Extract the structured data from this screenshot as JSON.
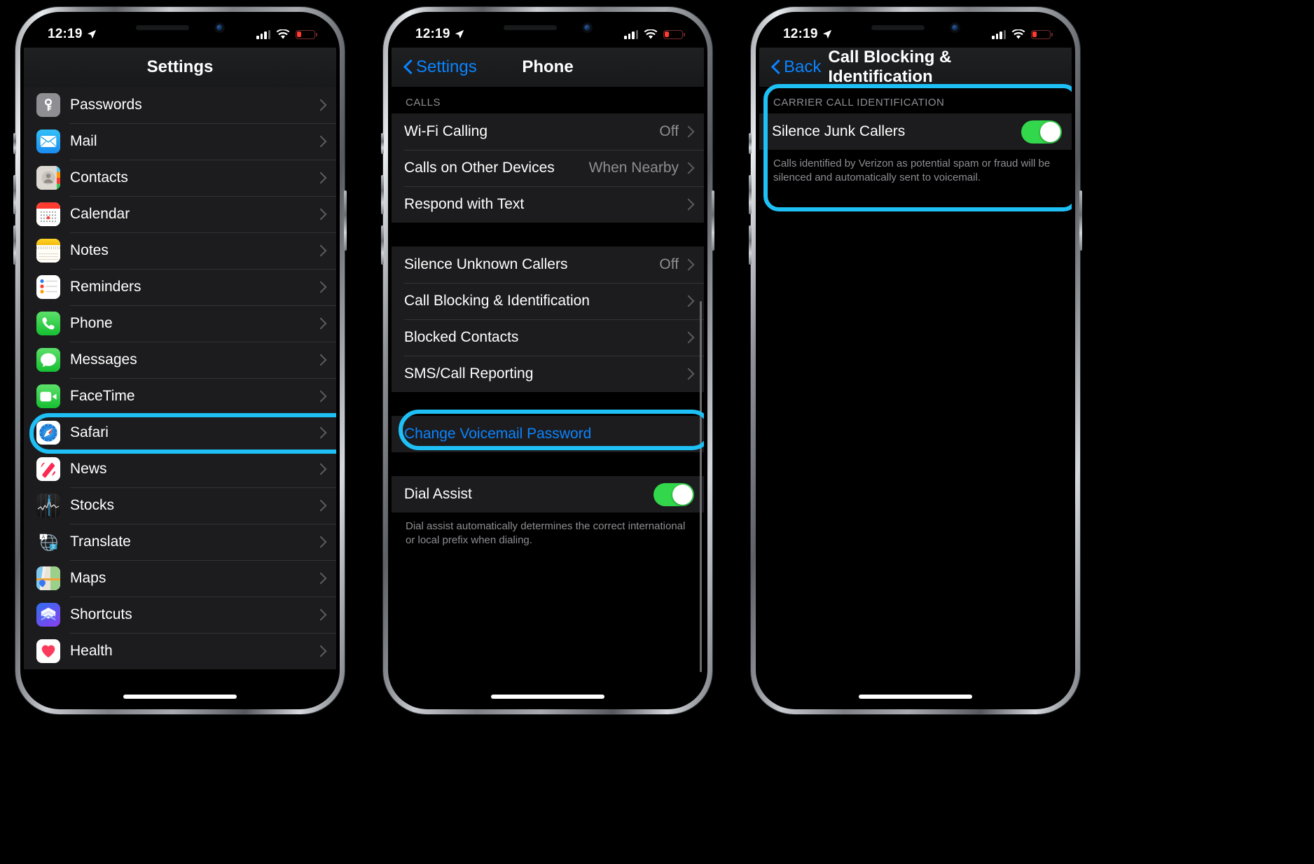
{
  "colors": {
    "highlight": "#1ec0f5",
    "accent_blue": "#0a84ff",
    "toggle_green": "#32d74b",
    "group_bg": "#1c1c1e",
    "secondary_text": "#8e8e93"
  },
  "status_bar": {
    "time": "12:19",
    "location_icon": "location-arrow-icon",
    "cellular_icon": "cellular-bars-icon",
    "wifi_icon": "wifi-icon",
    "battery_icon": "battery-low-icon"
  },
  "phone1": {
    "nav": {
      "title": "Settings"
    },
    "items": [
      {
        "label": "Passwords",
        "icon": "passwords-app-icon"
      },
      {
        "label": "Mail",
        "icon": "mail-app-icon"
      },
      {
        "label": "Contacts",
        "icon": "contacts-app-icon"
      },
      {
        "label": "Calendar",
        "icon": "calendar-app-icon"
      },
      {
        "label": "Notes",
        "icon": "notes-app-icon"
      },
      {
        "label": "Reminders",
        "icon": "reminders-app-icon"
      },
      {
        "label": "Phone",
        "icon": "phone-app-icon",
        "highlighted": true
      },
      {
        "label": "Messages",
        "icon": "messages-app-icon"
      },
      {
        "label": "FaceTime",
        "icon": "facetime-app-icon"
      },
      {
        "label": "Safari",
        "icon": "safari-app-icon"
      },
      {
        "label": "News",
        "icon": "news-app-icon"
      },
      {
        "label": "Stocks",
        "icon": "stocks-app-icon"
      },
      {
        "label": "Translate",
        "icon": "translate-app-icon"
      },
      {
        "label": "Maps",
        "icon": "maps-app-icon"
      },
      {
        "label": "Shortcuts",
        "icon": "shortcuts-app-icon"
      },
      {
        "label": "Health",
        "icon": "health-app-icon"
      }
    ]
  },
  "phone2": {
    "nav": {
      "back_label": "Settings",
      "title": "Phone"
    },
    "section_calls": {
      "header": "CALLS",
      "rows": [
        {
          "label": "Wi-Fi Calling",
          "value": "Off"
        },
        {
          "label": "Calls on Other Devices",
          "value": "When Nearby"
        },
        {
          "label": "Respond with Text",
          "value": ""
        }
      ]
    },
    "section_blocking": {
      "rows": [
        {
          "label": "Silence Unknown Callers",
          "value": "Off"
        },
        {
          "label": "Call Blocking & Identification",
          "value": "",
          "highlighted": true
        },
        {
          "label": "Blocked Contacts",
          "value": ""
        },
        {
          "label": "SMS/Call Reporting",
          "value": ""
        }
      ]
    },
    "section_voicemail": {
      "link_label": "Change Voicemail Password"
    },
    "section_dial": {
      "label": "Dial Assist",
      "toggle_on": true,
      "footer": "Dial assist automatically determines the correct international or local prefix when dialing."
    }
  },
  "phone3": {
    "nav": {
      "back_label": "Back",
      "title": "Call Blocking & Identification"
    },
    "section_carrier": {
      "header": "CARRIER CALL IDENTIFICATION",
      "row_label": "Silence Junk Callers",
      "toggle_on": true,
      "footer": "Calls identified by Verizon as potential spam or fraud will be silenced and automatically sent to voicemail.",
      "highlighted": true
    }
  }
}
